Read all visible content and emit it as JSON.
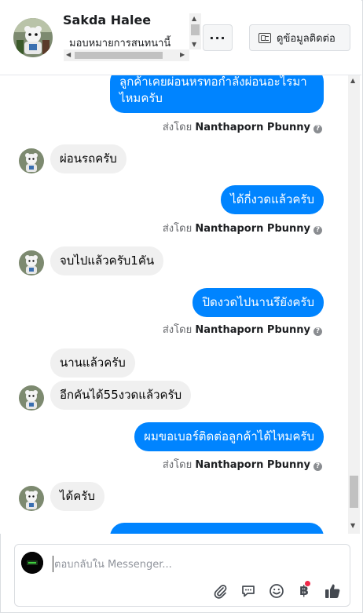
{
  "header": {
    "name": "Sakda Halee",
    "assign_text": "มอบหมายการสนทนานี้",
    "more_label": "···",
    "contact_label": "ดูข้อมูลติดต่อ"
  },
  "thread": {
    "sent_prefix": "ส่งโดย",
    "agent_name": "Nanthaporn Pbunny",
    "help_glyph": "?",
    "msg1": "ลูกค้าเคยผ่อนหรทอกำลังผ่อนอะไรมา ไหมครับ",
    "msg2": "ผ่อนรถครับ",
    "msg3": "ได้กี่งวดแล้วครับ",
    "msg4": "จบไปแล้วครับ1คัน",
    "msg5": "ปิดงวดไปนานรึยังครับ",
    "msg6": "นานแล้วครับ",
    "msg7": "อีกคันได้55งวดแล้วครับ",
    "msg8": "ผมขอเบอร์ติดต่อลูกค้าได้ไหมครับ",
    "msg9": "ได้ครับ"
  },
  "composer": {
    "placeholder": "ตอบกลับใน Messenger..."
  },
  "colors": {
    "outgoing_bubble": "#0084ff",
    "incoming_bubble": "#f0f0f0",
    "like_button": "#444950",
    "notification_dot": "#f02849"
  },
  "icons": {
    "contact": "contact-card-icon",
    "attach": "paperclip-icon",
    "chat": "chat-bubble-icon",
    "emoji": "smiley-icon",
    "payment": "baht-icon",
    "like": "thumbs-up-icon"
  }
}
